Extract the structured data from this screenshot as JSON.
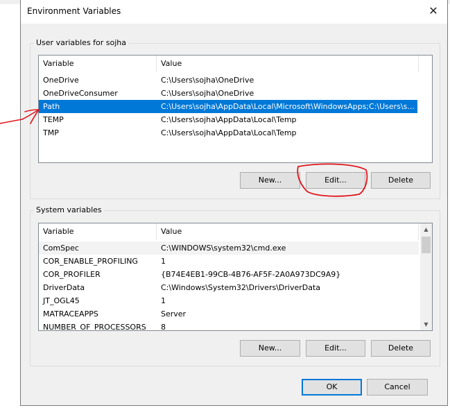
{
  "dialog": {
    "title": "Environment Variables",
    "close_icon": "close-icon",
    "ok_label": "OK",
    "cancel_label": "Cancel"
  },
  "user_vars": {
    "group_label": "User variables for sojha",
    "columns": [
      "Variable",
      "Value"
    ],
    "rows": [
      {
        "name": "OneDrive",
        "value": "C:\\Users\\sojha\\OneDrive"
      },
      {
        "name": "OneDriveConsumer",
        "value": "C:\\Users\\sojha\\OneDrive"
      },
      {
        "name": "Path",
        "value": "C:\\Users\\sojha\\AppData\\Local\\Microsoft\\WindowsApps;C:\\Users\\s..."
      },
      {
        "name": "TEMP",
        "value": "C:\\Users\\sojha\\AppData\\Local\\Temp"
      },
      {
        "name": "TMP",
        "value": "C:\\Users\\sojha\\AppData\\Local\\Temp"
      }
    ],
    "selected_row": "Path",
    "buttons": {
      "new": "New...",
      "edit": "Edit...",
      "delete": "Delete"
    }
  },
  "system_vars": {
    "group_label": "System variables",
    "columns": [
      "Variable",
      "Value"
    ],
    "rows": [
      {
        "name": "ComSpec",
        "value": "C:\\WINDOWS\\system32\\cmd.exe"
      },
      {
        "name": "COR_ENABLE_PROFILING",
        "value": "1"
      },
      {
        "name": "COR_PROFILER",
        "value": "{B74E4EB1-99CB-4B76-AF5F-2A0A973DC9A9}"
      },
      {
        "name": "DriverData",
        "value": "C:\\Windows\\System32\\Drivers\\DriverData"
      },
      {
        "name": "JT_OGL45",
        "value": "1"
      },
      {
        "name": "MATRACEAPPS",
        "value": "Server"
      },
      {
        "name": "NUMBER_OF_PROCESSORS",
        "value": "8"
      }
    ],
    "buttons": {
      "new": "New...",
      "edit": "Edit...",
      "delete": "Delete"
    }
  },
  "colors": {
    "selection": "#0078d7",
    "annotation": "#e0151b",
    "dialog_bg": "#f0f0f0"
  }
}
